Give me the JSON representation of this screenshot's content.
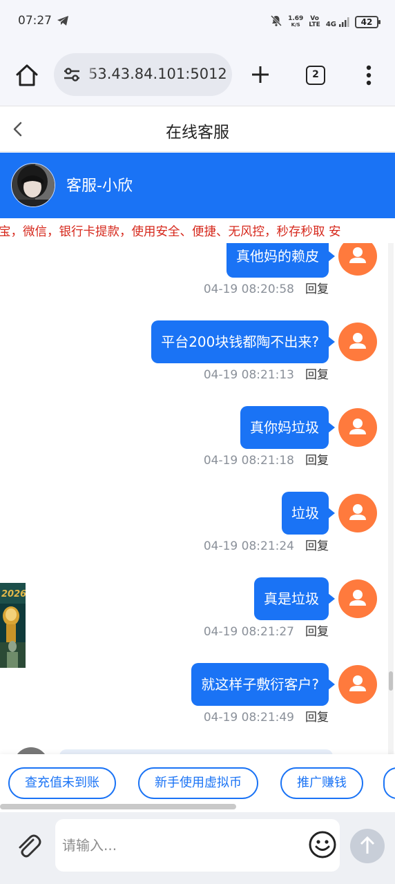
{
  "status_bar": {
    "time": "07:27",
    "net_speed": "1.69",
    "net_unit": "K/S",
    "vo": "Vo",
    "lte": "LTE",
    "signal": "4G",
    "battery": "42"
  },
  "browser": {
    "url": "53.43.84.101:5012",
    "tab_count": "2"
  },
  "page": {
    "title": "在线客服"
  },
  "agent": {
    "name": "客服-小欣"
  },
  "marquee": {
    "text": "宝，微信，银行卡提款，使用安全、便捷、无风控，秒存秒取 安"
  },
  "messages": [
    {
      "text": "真他妈的赖皮",
      "time": "04-19 08:20:58",
      "reply": "回复"
    },
    {
      "text": "平台200块钱都陶不出来?",
      "time": "04-19 08:21:13",
      "reply": "回复"
    },
    {
      "text": "真你妈垃圾",
      "time": "04-19 08:21:18",
      "reply": "回复"
    },
    {
      "text": "垃圾",
      "time": "04-19 08:21:24",
      "reply": "回复"
    },
    {
      "text": "真是垃圾",
      "time": "04-19 08:21:27",
      "reply": "回复"
    },
    {
      "text": "就这样子敷衍客户?",
      "time": "04-19 08:21:49",
      "reply": "回复"
    }
  ],
  "quick_replies": [
    "查充值未到账",
    "新手使用虚拟币",
    "推广赚钱"
  ],
  "input": {
    "placeholder": "请输入..."
  },
  "colors": {
    "primary": "#1a73f5",
    "user_avatar": "#ff7a3d",
    "marquee": "#d6281c"
  }
}
